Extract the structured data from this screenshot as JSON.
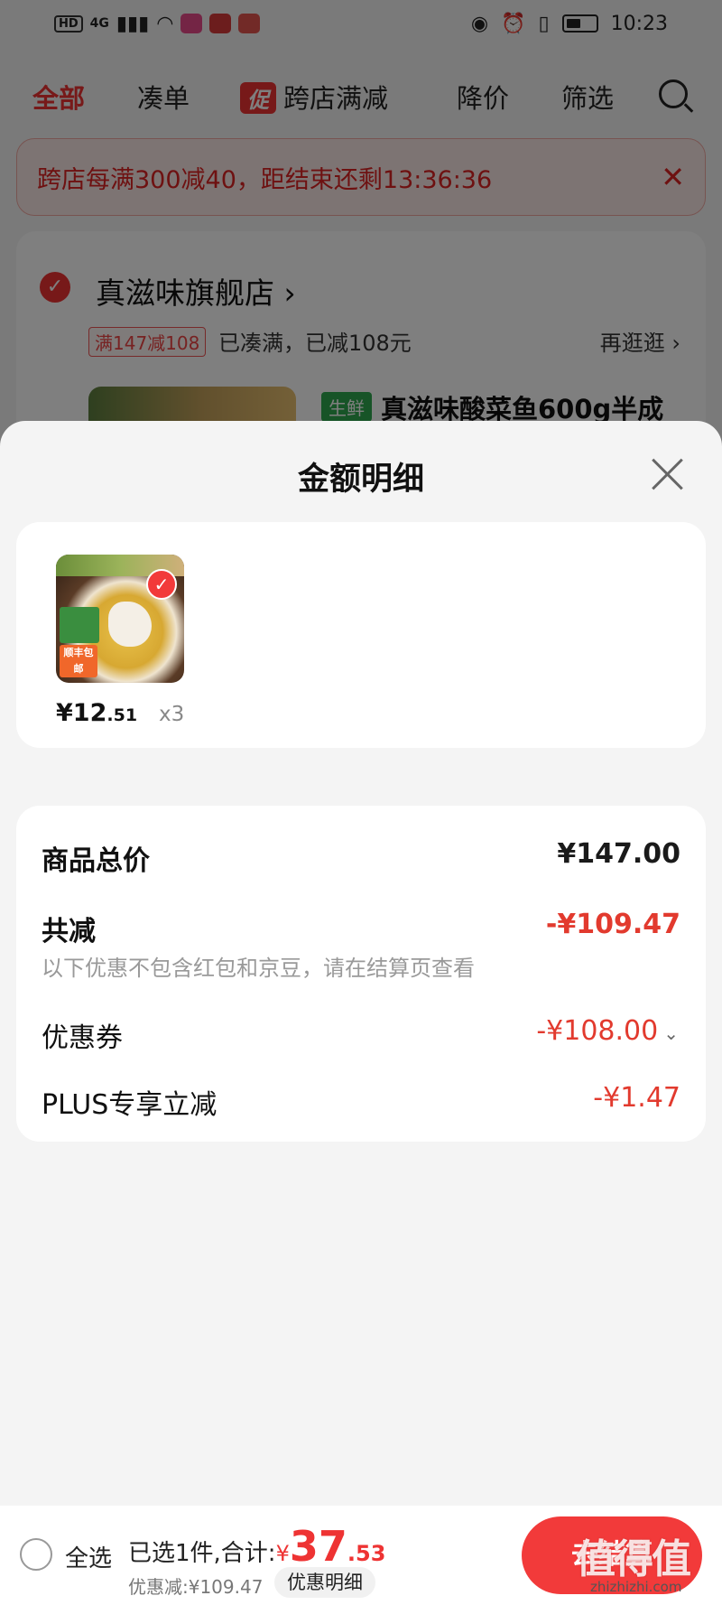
{
  "status_bar": {
    "left_chip": "HD",
    "network": "4G",
    "time": "10:23"
  },
  "top_tabs": {
    "all": "全部",
    "bundle": "凑单",
    "promo_badge": "促",
    "cross_store": "跨店满减",
    "price_drop": "降价",
    "filter": "筛选",
    "search_icon": "search-icon"
  },
  "promo_banner": {
    "text": "跨店每满300减40，距结束还剩13:36:36",
    "close": "✕"
  },
  "store": {
    "name": "真滋味旗舰店",
    "name_arrow": "›",
    "coupon_tag": "满147减108",
    "coupon_status": "已凑满，已减108元",
    "shop_more": "再逛逛 ›",
    "fresh_tag": "生鲜",
    "product_title": "真滋味酸菜鱼600g半成"
  },
  "sheet": {
    "title": "金额明细",
    "item": {
      "price_int": "¥12",
      "price_dec": ".51",
      "qty": "x3",
      "image_label": "顺丰包邮"
    },
    "rows": {
      "total_label": "商品总价",
      "total_value": "¥147.00",
      "discount_label": "共减",
      "discount_value": "-¥109.47",
      "note": "以下优惠不包含红包和京豆，请在结算页查看",
      "coupon_label": "优惠券",
      "coupon_value": "-¥108.00",
      "plus_label": "PLUS专享立减",
      "plus_value": "-¥1.47"
    }
  },
  "bottom_bar": {
    "select_all": "全选",
    "selected_prefix": "已选1件,合计:",
    "currency": "¥",
    "total_int": "37",
    "total_dec": ".53",
    "discount_line": "优惠减:¥109.47",
    "detail_chip": "优惠明细",
    "checkout": "去结算",
    "watermark": "值得值",
    "watermark_sub": "zhizhizhi.com"
  },
  "colors": {
    "accent_red": "#e33a2e",
    "fresh_green": "#2fa84f"
  }
}
